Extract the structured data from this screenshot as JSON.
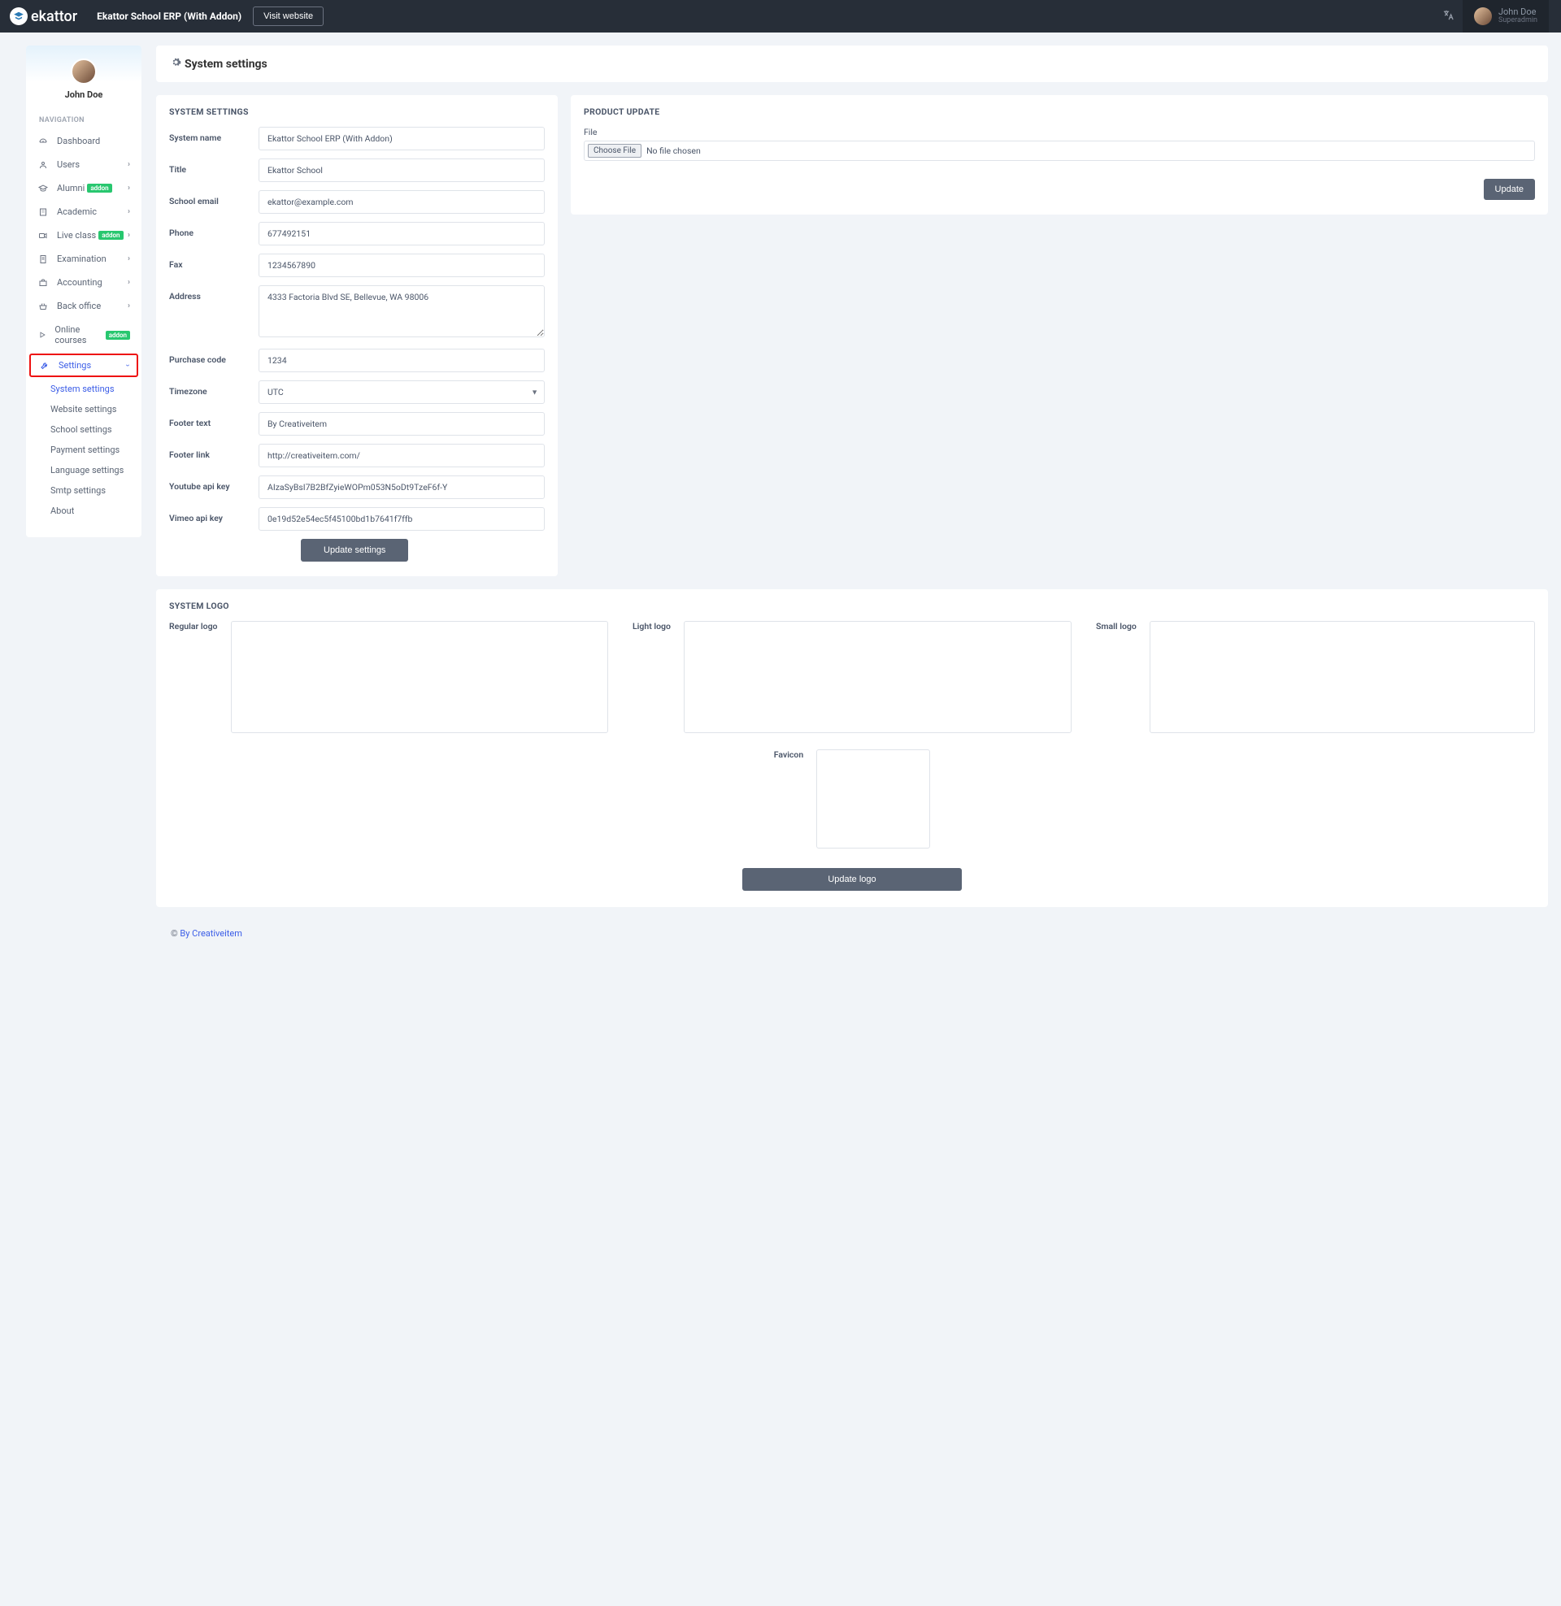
{
  "topbar": {
    "brand": "ekattor",
    "app_title": "Ekattor School ERP (With Addon)",
    "visit_label": "Visit website",
    "user_name": "John Doe",
    "user_role": "Superadmin"
  },
  "sidebar": {
    "username": "John Doe",
    "heading": "NAVIGATION",
    "items": {
      "dashboard": "Dashboard",
      "users": "Users",
      "alumni": "Alumni",
      "academic": "Academic",
      "liveclass": "Live class",
      "examination": "Examination",
      "accounting": "Accounting",
      "backoffice": "Back office",
      "onlinecourses": "Online courses",
      "settings": "Settings"
    },
    "addon_badge": "addon",
    "sub": {
      "system": "System settings",
      "website": "Website settings",
      "school": "School settings",
      "payment": "Payment settings",
      "language": "Language settings",
      "smtp": "Smtp settings",
      "about": "About"
    }
  },
  "page": {
    "title": "System settings"
  },
  "settings_form": {
    "title": "SYSTEM SETTINGS",
    "labels": {
      "system_name": "System name",
      "title": "Title",
      "school_email": "School email",
      "phone": "Phone",
      "fax": "Fax",
      "address": "Address",
      "purchase_code": "Purchase code",
      "timezone": "Timezone",
      "footer_text": "Footer text",
      "footer_link": "Footer link",
      "youtube_api": "Youtube api key",
      "vimeo_api": "Vimeo api key"
    },
    "values": {
      "system_name": "Ekattor School ERP (With Addon)",
      "title": "Ekattor School",
      "school_email": "ekattor@example.com",
      "phone": "677492151",
      "fax": "1234567890",
      "address": "4333 Factoria Blvd SE, Bellevue, WA 98006",
      "purchase_code": "1234",
      "timezone": "UTC",
      "footer_text": "By Creativeitem",
      "footer_link": "http://creativeitem.com/",
      "youtube_api": "AIzaSyBsI7B2BfZyieWOPm053N5oDt9TzeF6f-Y",
      "vimeo_api": "0e19d52e54ec5f45100bd1b7641f7ffb"
    },
    "submit": "Update settings"
  },
  "product_update": {
    "title": "PRODUCT UPDATE",
    "file_label": "File",
    "choose": "Choose File",
    "nofile": "No file chosen",
    "submit": "Update"
  },
  "system_logo": {
    "title": "SYSTEM LOGO",
    "regular": "Regular logo",
    "light": "Light logo",
    "small": "Small logo",
    "favicon": "Favicon",
    "submit": "Update logo"
  },
  "footer": {
    "copy": "© ",
    "link": "By Creativeitem"
  }
}
